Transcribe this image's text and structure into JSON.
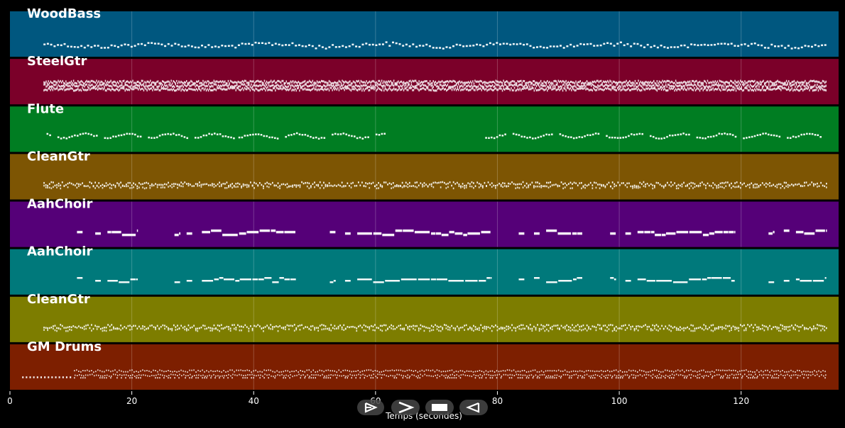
{
  "chart_data": {
    "type": "piano-roll",
    "xlabel": "Temps (secondes)",
    "xlim": [
      0,
      136
    ],
    "xticks": [
      0,
      20,
      40,
      60,
      80,
      100,
      120
    ],
    "tracks": [
      {
        "name": "WoodBass",
        "color": "#00577f",
        "start": 5.5,
        "end": 134,
        "style": "bass"
      },
      {
        "name": "SteelGtr",
        "color": "#7b0029",
        "start": 5.5,
        "end": 134,
        "style": "dense"
      },
      {
        "name": "Flute",
        "color": "#007d22",
        "start": 6,
        "end": 133,
        "style": "melody",
        "gaps": [
          [
            61.5,
            78
          ]
        ]
      },
      {
        "name": "CleanGtr",
        "color": "#7d5503",
        "start": 5.5,
        "end": 134,
        "style": "strum"
      },
      {
        "name": "AahChoir",
        "color": "#550078",
        "start": 11,
        "end": 134,
        "style": "choir"
      },
      {
        "name": "AahChoir",
        "color": "#00797b",
        "start": 11,
        "end": 133,
        "style": "choir-thin"
      },
      {
        "name": "CleanGtr",
        "color": "#7d7d00",
        "start": 5.5,
        "end": 134,
        "style": "strum"
      },
      {
        "name": "GM Drums",
        "color": "#7d1f00",
        "start": 2,
        "end": 134,
        "style": "drums"
      }
    ]
  },
  "controls": {
    "play": "play-button",
    "forward": "forward-button",
    "stop": "stop-button",
    "back": "back-button"
  }
}
